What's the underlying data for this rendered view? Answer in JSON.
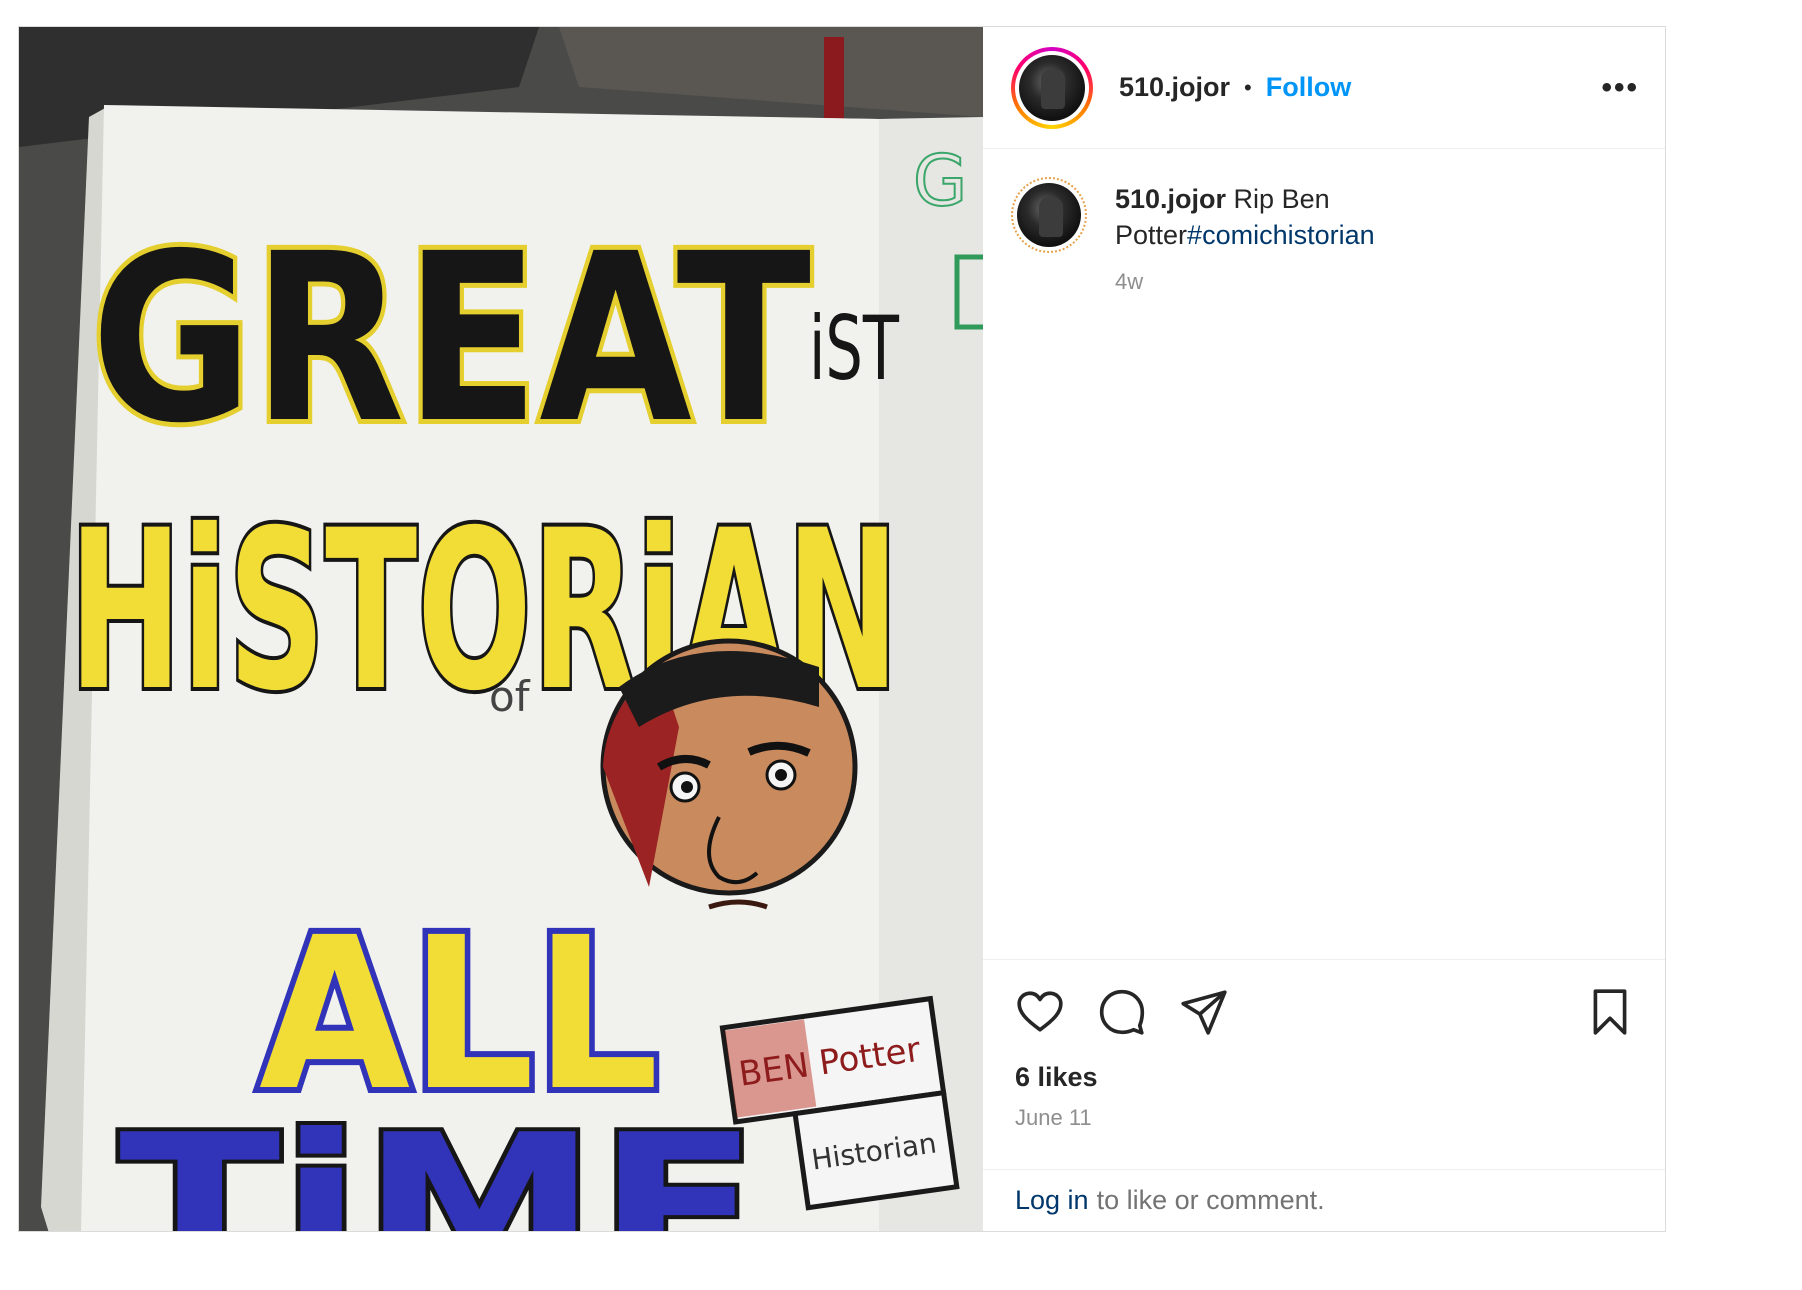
{
  "post": {
    "username": "510.jojor",
    "separator": "•",
    "follow_label": "Follow",
    "more_label": "•••",
    "caption": {
      "username": "510.jojor",
      "text": " Rip Ben Potter",
      "hashtag": "#comichistorian",
      "age": "4w"
    },
    "likes": "6 likes",
    "date": "June 11",
    "login": {
      "link": "Log in",
      "text": "to like or comment."
    }
  },
  "artwork": {
    "line1": "GREAT",
    "line1_suffix": "iST",
    "line2": "HiSTORiAN",
    "small_word": "of",
    "line3": "ALL",
    "line4": "TiME",
    "badge_top": "BEN Potter",
    "badge_bottom": "Historian",
    "edge_letter": "G"
  },
  "icons": {
    "heart": "heart-icon",
    "comment": "comment-icon",
    "share": "share-icon",
    "save": "bookmark-icon",
    "more": "more-options-icon"
  },
  "colors": {
    "accent": "#0095f6",
    "link": "#00376b",
    "yellow_paint": "#f2dd37",
    "blue_paint": "#3133b8"
  }
}
